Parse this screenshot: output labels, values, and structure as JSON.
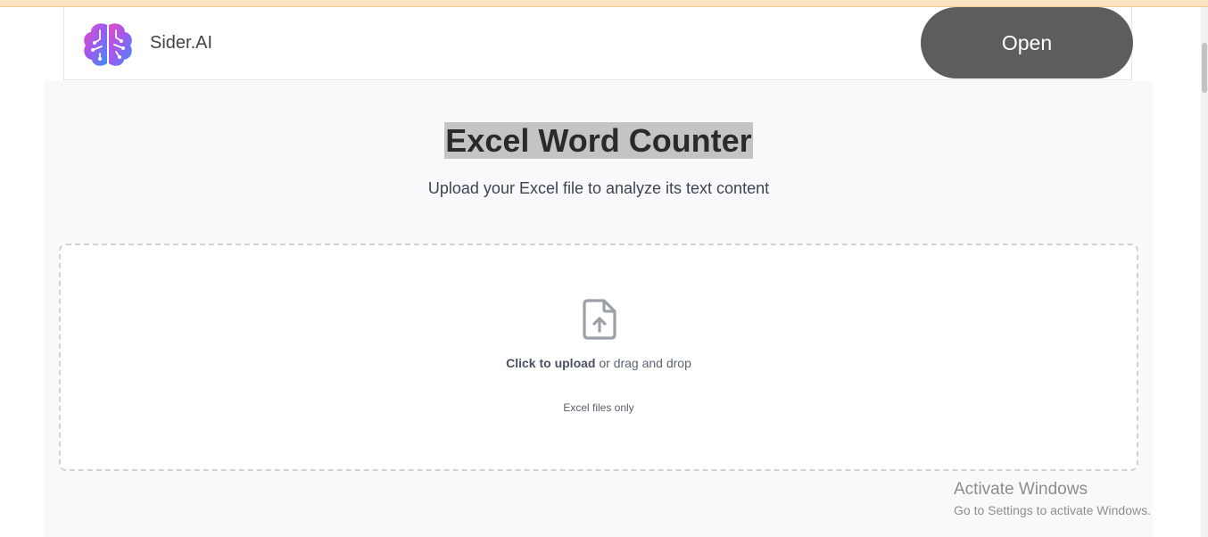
{
  "ad": {
    "brand_name": "Sider.AI",
    "open_label": "Open",
    "logo_icon": "brain-logo-icon"
  },
  "header": {
    "title": "Excel Word Counter",
    "subtitle": "Upload your Excel file to analyze its text content"
  },
  "upload": {
    "icon": "file-upload-icon",
    "click_label": "Click to upload",
    "drag_label": " or drag and drop",
    "hint": "Excel files only"
  },
  "watermark": {
    "title": "Activate Windows",
    "subtitle": "Go to Settings to activate Windows."
  },
  "colors": {
    "open_button": "#5d5d5d",
    "panel_bg": "#f8f9fb",
    "title_highlight": "#c4c4c4",
    "logo_gradient_start": "#e84ac8",
    "logo_gradient_end": "#3f8ef5"
  }
}
